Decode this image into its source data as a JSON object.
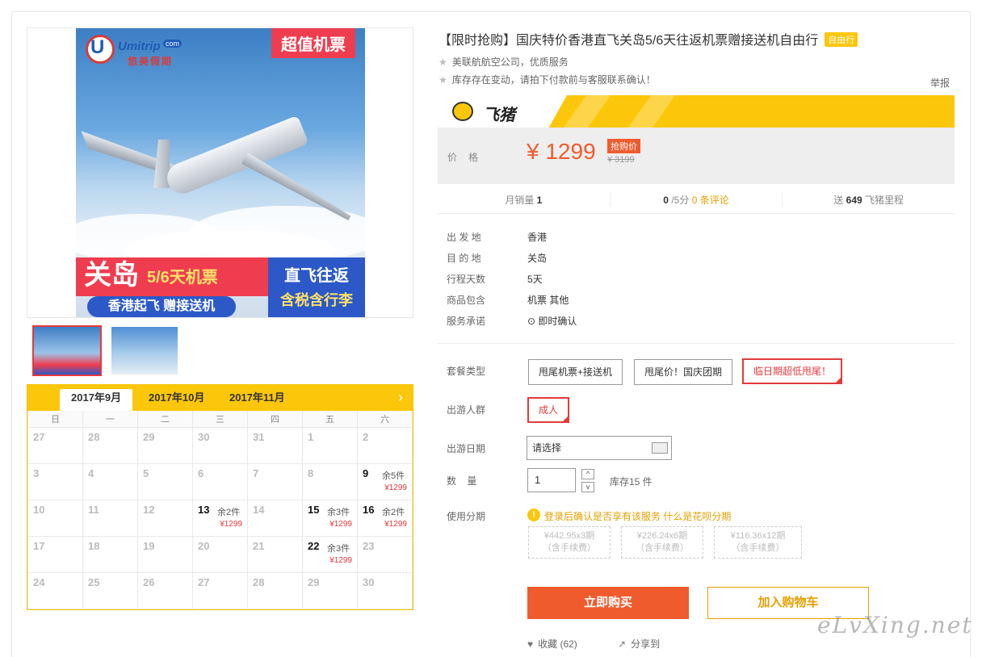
{
  "product": {
    "title": "【限时抢购】国庆特价香港直飞关岛5/6天往返机票赠接送机自由行",
    "badge": "自由行",
    "sub1": "美联航航空公司，优质服务",
    "sub2": "库存存在变动，请拍下付款前与客服联系确认！",
    "report": "举报"
  },
  "poster": {
    "logo_text": "Umitrip",
    "logo_com": "com",
    "logo_cn": "悠美假期",
    "tag": "超值机票",
    "guam": "关岛",
    "days": "5/6天机票",
    "blue_text": "香港起飞  赠接送机",
    "right_l1": "直飞往返",
    "right_l2": "含税含行李"
  },
  "fliggy": {
    "logo": "飞猪"
  },
  "price": {
    "label": "价格",
    "current": "¥ 1299",
    "tag": "抢购价",
    "original": "¥ 3199"
  },
  "stats": {
    "sales_label": "月销量",
    "sales": "1",
    "rating": "0",
    "rating_suffix": "/5分",
    "reviews": "0 条评论",
    "miles_prefix": "送",
    "miles": "649",
    "miles_suffix": "飞猪里程"
  },
  "info": [
    {
      "k": "出 发 地",
      "v": "香港"
    },
    {
      "k": "目 的 地",
      "v": "关岛"
    },
    {
      "k": "行程天数",
      "v": "5天"
    },
    {
      "k": "商品包含",
      "v": "机票  其他"
    },
    {
      "k": "服务承诺",
      "v": "即时确认"
    }
  ],
  "options": {
    "package_label": "套餐类型",
    "packages": [
      "甩尾机票+接送机",
      "甩尾价！国庆团期",
      "临日期超低甩尾！"
    ],
    "crowd_label": "出游人群",
    "crowd": "成人",
    "date_label": "出游日期",
    "date_placeholder": "请选择",
    "qty_label": "数    量",
    "qty": "1",
    "stock": "库存15 件",
    "inst_label": "使用分期",
    "inst_warn": "登录后确认是否享有该服务 什么是花呗分期",
    "installments": [
      {
        "l1": "¥442.95x3期",
        "l2": "（含手续费）"
      },
      {
        "l1": "¥226.24x6期",
        "l2": "（含手续费）"
      },
      {
        "l1": "¥116.36x12期",
        "l2": "（含手续费）"
      }
    ]
  },
  "actions": {
    "buy": "立即购买",
    "cart": "加入购物车",
    "fav": "收藏 (62)",
    "share": "分享到"
  },
  "calendar": {
    "tabs": [
      "2017年9月",
      "2017年10月",
      "2017年11月"
    ],
    "weekdays": [
      "日",
      "一",
      "二",
      "三",
      "四",
      "五",
      "六"
    ],
    "weeks": [
      [
        {
          "d": "27"
        },
        {
          "d": "28"
        },
        {
          "d": "29"
        },
        {
          "d": "30"
        },
        {
          "d": "31"
        },
        {
          "d": "1"
        },
        {
          "d": "2"
        }
      ],
      [
        {
          "d": "3"
        },
        {
          "d": "4"
        },
        {
          "d": "5"
        },
        {
          "d": "6"
        },
        {
          "d": "7"
        },
        {
          "d": "8"
        },
        {
          "d": "9",
          "left": "余5件",
          "price": "¥1299"
        }
      ],
      [
        {
          "d": "10"
        },
        {
          "d": "11"
        },
        {
          "d": "12"
        },
        {
          "d": "13",
          "left": "余2件",
          "price": "¥1299"
        },
        {
          "d": "14"
        },
        {
          "d": "15",
          "left": "余3件",
          "price": "¥1299"
        },
        {
          "d": "16",
          "left": "余2件",
          "price": "¥1299"
        }
      ],
      [
        {
          "d": "17"
        },
        {
          "d": "18"
        },
        {
          "d": "19"
        },
        {
          "d": "20"
        },
        {
          "d": "21"
        },
        {
          "d": "22",
          "left": "余3件",
          "price": "¥1299"
        },
        {
          "d": "23"
        }
      ],
      [
        {
          "d": "24"
        },
        {
          "d": "25"
        },
        {
          "d": "26"
        },
        {
          "d": "27"
        },
        {
          "d": "28"
        },
        {
          "d": "29"
        },
        {
          "d": "30"
        }
      ]
    ]
  },
  "watermark": "eLvXing.net",
  "colors": {
    "accent": "#f05b2d",
    "fliggy": "#fcc70b",
    "red": "#e4393c"
  }
}
